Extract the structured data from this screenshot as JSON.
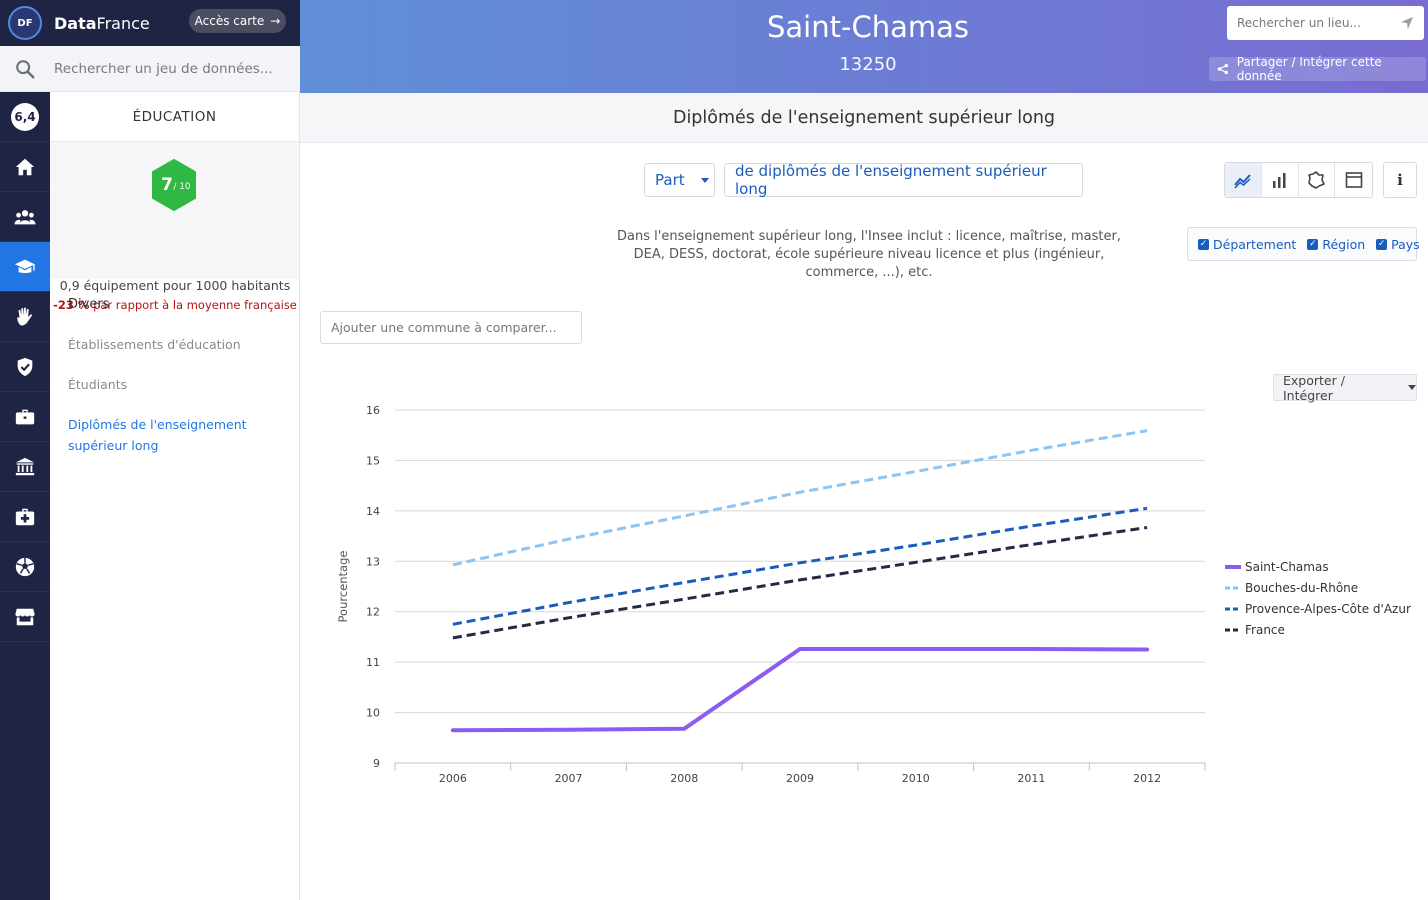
{
  "brand": {
    "name_bold": "Data",
    "name_light": "France",
    "logo_text": "DF",
    "map_button": "Accès carte",
    "map_arrow": "→"
  },
  "dataset_search": {
    "placeholder": "Rechercher un jeu de données..."
  },
  "rail": {
    "score": "6,4",
    "items": [
      {
        "icon": "home-icon"
      },
      {
        "icon": "people-icon"
      },
      {
        "icon": "graduation-cap-icon",
        "active": true
      },
      {
        "icon": "hand-icon"
      },
      {
        "icon": "shield-icon"
      },
      {
        "icon": "briefcase-icon"
      },
      {
        "icon": "institution-icon"
      },
      {
        "icon": "medical-kit-icon"
      },
      {
        "icon": "soccer-ball-icon"
      },
      {
        "icon": "store-icon"
      }
    ]
  },
  "panel": {
    "heading": "ÉDUCATION",
    "score_value": "7",
    "score_max": "/ 10",
    "equipment_text": "0,9 équipement pour 1000 habitants",
    "compare_value": "-23 %",
    "compare_text": " par rapport à la moyenne française",
    "group_label": "Divers",
    "links": [
      {
        "label": "Établissements d'éducation"
      },
      {
        "label": "Étudiants"
      },
      {
        "label": "Diplômés de l'enseignement supérieur long",
        "active": true
      }
    ]
  },
  "header": {
    "city": "Saint-Chamas",
    "zip": "13250",
    "place_search_placeholder": "Rechercher un lieu...",
    "share_label": "Partager / Intégrer cette donnée"
  },
  "section": {
    "title": "Diplômés de l'enseignement supérieur long"
  },
  "controls": {
    "part_label": "Part",
    "measure_label": "de diplômés de l'enseignement supérieur long",
    "viz_buttons": [
      "line-chart-icon",
      "bar-chart-icon",
      "map-icon",
      "table-icon"
    ],
    "info_label": "i",
    "description": "Dans l'enseignement supérieur long, l'Insee inclut : licence, maîtrise, master, DEA, DESS, doctorat, école supérieure niveau licence et plus (ingénieur, commerce, ...), etc.",
    "scope": {
      "departement": "Département",
      "region": "Région",
      "pays": "Pays"
    },
    "compare_placeholder": "Ajouter une commune à comparer...",
    "export_label": "Exporter / Intégrer"
  },
  "colors": {
    "saint_chamas": "#8b5cf0",
    "bouches_du_rhone": "#8ec4f2",
    "paca": "#1a5cbd",
    "france": "#232a45",
    "accent": "#2176e3"
  },
  "chart_data": {
    "type": "line",
    "x": [
      2006,
      2007,
      2008,
      2009,
      2010,
      2011,
      2012
    ],
    "xlabel": "",
    "ylabel": "Pourcentage",
    "ylim": [
      9,
      16
    ],
    "yticks": [
      9,
      10,
      11,
      12,
      13,
      14,
      15,
      16
    ],
    "grid": true,
    "legend_position": "right",
    "series": [
      {
        "name": "Saint-Chamas",
        "values": [
          9.65,
          9.66,
          9.68,
          11.26,
          11.26,
          11.26,
          11.25
        ],
        "dash": false,
        "color": "#8b5cf0"
      },
      {
        "name": "Bouches-du-Rhône",
        "values": [
          12.93,
          13.44,
          13.9,
          14.37,
          14.78,
          15.2,
          15.59
        ],
        "dash": true,
        "color": "#8ec4f2"
      },
      {
        "name": "Provence-Alpes-Côte d'Azur",
        "values": [
          11.75,
          12.18,
          12.58,
          12.97,
          13.32,
          13.7,
          14.05
        ],
        "dash": true,
        "color": "#1a5cbd"
      },
      {
        "name": "France",
        "values": [
          11.48,
          11.88,
          12.25,
          12.63,
          12.98,
          13.33,
          13.67
        ],
        "dash": true,
        "color": "#232a45"
      }
    ]
  }
}
